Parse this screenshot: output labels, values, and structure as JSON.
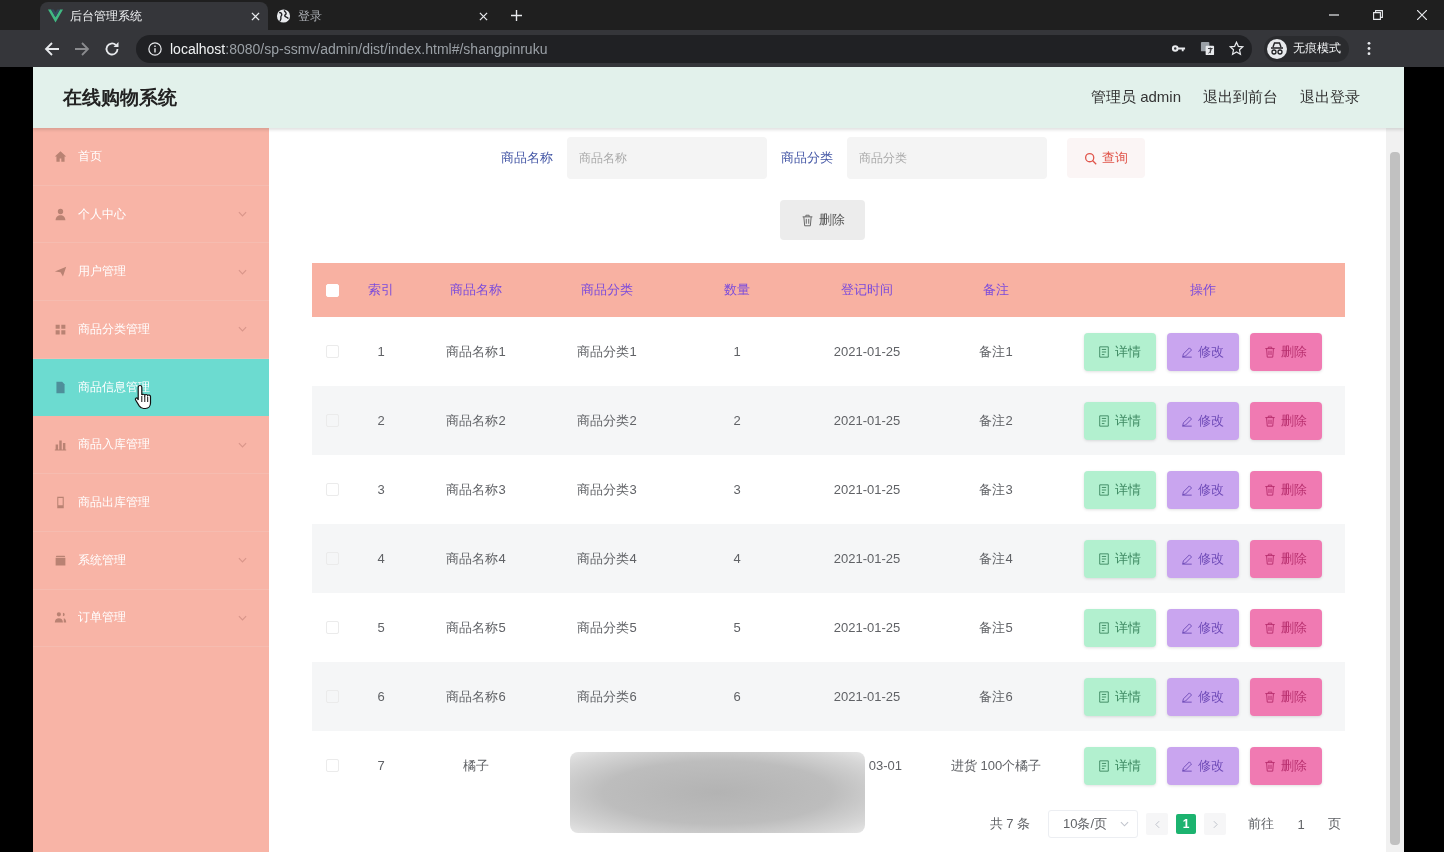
{
  "browser": {
    "tabs": [
      {
        "title": "后台管理系统",
        "selected": true
      },
      {
        "title": "登录",
        "selected": false
      }
    ],
    "url": {
      "host": "localhost",
      "path": ":8080/sp-ssmv/admin/dist/index.html#/shangpinruku"
    },
    "profile": "无痕模式"
  },
  "header": {
    "title": "在线购物系统",
    "user": "管理员 admin",
    "links": [
      "退出到前台",
      "退出登录"
    ]
  },
  "sidebar": {
    "items": [
      {
        "label": "首页",
        "selected": false,
        "has_submenu": false
      },
      {
        "label": "个人中心",
        "selected": false,
        "has_submenu": true
      },
      {
        "label": "用户管理",
        "selected": false,
        "has_submenu": true
      },
      {
        "label": "商品分类管理",
        "selected": false,
        "has_submenu": true
      },
      {
        "label": "商品信息管理",
        "selected": true,
        "has_submenu": false
      },
      {
        "label": "商品入库管理",
        "selected": false,
        "has_submenu": true
      },
      {
        "label": "商品出库管理",
        "selected": false,
        "has_submenu": false
      },
      {
        "label": "系统管理",
        "selected": false,
        "has_submenu": true
      },
      {
        "label": "订单管理",
        "selected": false,
        "has_submenu": true
      }
    ]
  },
  "search": {
    "fields": [
      {
        "label": "商品名称",
        "placeholder": "商品名称"
      },
      {
        "label": "商品分类",
        "placeholder": "商品分类"
      }
    ],
    "button": "查询"
  },
  "toolbar": {
    "delete_button": "删除"
  },
  "table": {
    "select_all": {
      "checked": false
    },
    "columns": [
      "索引",
      "商品名称",
      "商品分类",
      "数量",
      "登记时间",
      "备注",
      "操作"
    ],
    "rows": [
      {
        "index": "1",
        "name": "商品名称1",
        "category": "商品分类1",
        "quantity": "1",
        "date": "2021-01-25",
        "note": "备注1",
        "checked": false,
        "obscured": false,
        "actions": [
          {
            "kind": "detail",
            "label": "详情"
          },
          {
            "kind": "edit",
            "label": "修改"
          },
          {
            "kind": "delete",
            "label": "删除"
          }
        ]
      },
      {
        "index": "2",
        "name": "商品名称2",
        "category": "商品分类2",
        "quantity": "2",
        "date": "2021-01-25",
        "note": "备注2",
        "checked": false,
        "obscured": false,
        "actions": [
          {
            "kind": "detail",
            "label": "详情"
          },
          {
            "kind": "edit",
            "label": "修改"
          },
          {
            "kind": "delete",
            "label": "删除"
          }
        ]
      },
      {
        "index": "3",
        "name": "商品名称3",
        "category": "商品分类3",
        "quantity": "3",
        "date": "2021-01-25",
        "note": "备注3",
        "checked": false,
        "obscured": false,
        "actions": [
          {
            "kind": "detail",
            "label": "详情"
          },
          {
            "kind": "edit",
            "label": "修改"
          },
          {
            "kind": "delete",
            "label": "删除"
          }
        ]
      },
      {
        "index": "4",
        "name": "商品名称4",
        "category": "商品分类4",
        "quantity": "4",
        "date": "2021-01-25",
        "note": "备注4",
        "checked": false,
        "obscured": false,
        "actions": [
          {
            "kind": "detail",
            "label": "详情"
          },
          {
            "kind": "edit",
            "label": "修改"
          },
          {
            "kind": "delete",
            "label": "删除"
          }
        ]
      },
      {
        "index": "5",
        "name": "商品名称5",
        "category": "商品分类5",
        "quantity": "5",
        "date": "2021-01-25",
        "note": "备注5",
        "checked": false,
        "obscured": false,
        "actions": [
          {
            "kind": "detail",
            "label": "详情"
          },
          {
            "kind": "edit",
            "label": "修改"
          },
          {
            "kind": "delete",
            "label": "删除"
          }
        ]
      },
      {
        "index": "6",
        "name": "商品名称6",
        "category": "商品分类6",
        "quantity": "6",
        "date": "2021-01-25",
        "note": "备注6",
        "checked": false,
        "obscured": false,
        "actions": [
          {
            "kind": "detail",
            "label": "详情"
          },
          {
            "kind": "edit",
            "label": "修改"
          },
          {
            "kind": "delete",
            "label": "删除"
          }
        ]
      },
      {
        "index": "7",
        "name": "橘子",
        "date": "03-01",
        "note": "进货 100个橘子",
        "checked": false,
        "obscured": true,
        "actions": [
          {
            "kind": "detail",
            "label": "详情"
          },
          {
            "kind": "edit",
            "label": "修改"
          },
          {
            "kind": "delete",
            "label": "删除"
          }
        ]
      }
    ]
  },
  "pagination": {
    "total": "共 7 条",
    "page_size": "10条/页",
    "pages": [
      {
        "label": "1",
        "selected": true
      }
    ],
    "goto_label": "前往",
    "goto_value": "1",
    "page_suffix": "页"
  }
}
